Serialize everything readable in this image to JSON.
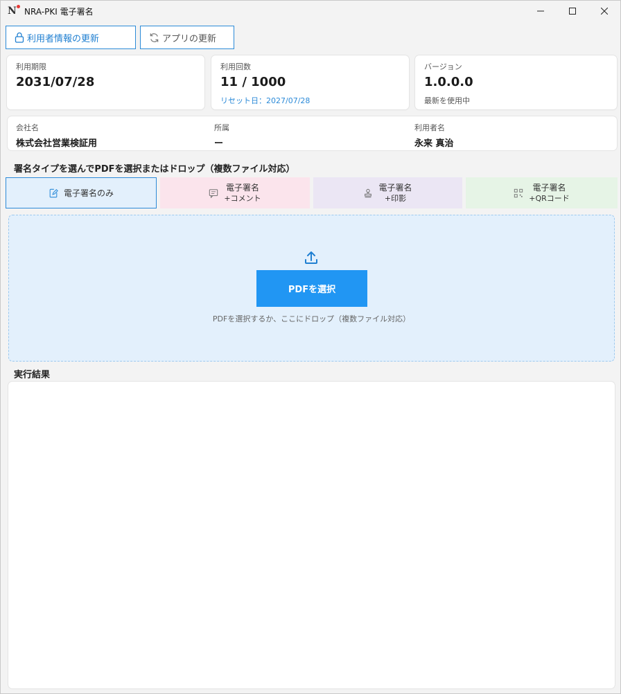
{
  "window": {
    "title": "NRA-PKI 電子署名",
    "logo_letter": "N"
  },
  "toolbar": {
    "user_info_update": "利用者情報の更新",
    "app_update": "アプリの更新"
  },
  "cards": {
    "period": {
      "label": "利用期限",
      "value": "2031/07/28"
    },
    "usage": {
      "label": "利用回数",
      "value": "11 / 1000",
      "sub": "リセット日：2027/07/28"
    },
    "version": {
      "label": "バージョン",
      "value": "1.0.0.0",
      "sub": "最新を使用中"
    }
  },
  "info": {
    "company_label": "会社名",
    "company_value": "株式会社営業検証用",
    "dept_label": "所属",
    "dept_value": "ー",
    "user_label": "利用者名",
    "user_value": "永来 真治"
  },
  "sign_section": {
    "title": "署名タイプを選んでPDFを選択またはドロップ（複数ファイル対応）",
    "types": [
      {
        "label": "電子署名のみ",
        "sub": ""
      },
      {
        "label": "電子署名",
        "sub": "+コメント"
      },
      {
        "label": "電子署名",
        "sub": "+印影"
      },
      {
        "label": "電子署名",
        "sub": "+QRコード"
      }
    ]
  },
  "dropzone": {
    "button": "PDFを選択",
    "hint": "PDFを選択するか、ここにドロップ（複数ファイル対応）"
  },
  "result": {
    "title": "実行結果"
  },
  "colors": {
    "accent": "#2196f3",
    "border_blue": "#2b8ad8",
    "pink": "#fbe4ec",
    "purple": "#ebe6f4",
    "green": "#e6f4e6"
  }
}
